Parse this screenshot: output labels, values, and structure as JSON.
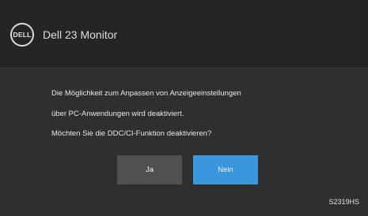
{
  "header": {
    "logo_text": "DELL",
    "title": "Dell 23 Monitor"
  },
  "dialog": {
    "message_lines": [
      "Die Möglichkeit zum Anpassen von Anzeigeeinstellungen",
      "über PC-Anwendungen wird deaktiviert.",
      "Möchten Sie die DDC/CI-Funktion deaktivieren?"
    ],
    "buttons": {
      "yes_label": "Ja",
      "no_label": "Nein"
    }
  },
  "footer": {
    "model": "S2319HS"
  },
  "colors": {
    "background": "#2f2f2f",
    "header_background": "#252525",
    "selected_button": "#3a96dd",
    "unselected_button": "#505050"
  },
  "icons": {
    "logo": "dell-logo-icon"
  }
}
